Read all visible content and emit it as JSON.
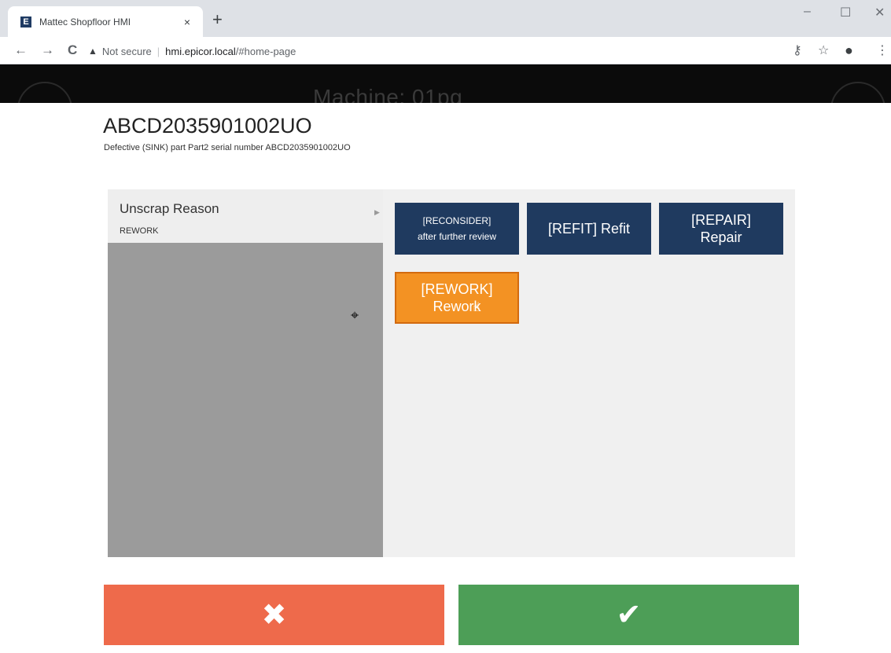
{
  "browser": {
    "tab_title": "Mattec Shopfloor HMI",
    "tab_close": "×",
    "new_tab": "+",
    "favicon_letter": "E",
    "security_label": "Not secure",
    "url_host": "hmi.epicor.local",
    "url_path": "/#home-page",
    "back_icon": "←",
    "forward_icon": "→",
    "reload_icon": "C",
    "key_icon": "⚷",
    "star_icon": "☆",
    "account_icon": "●",
    "menu_icon": "⋮",
    "minimize": "–",
    "maximize": "☐",
    "close": "✕"
  },
  "header": {
    "machine_title": "Machine: 01pg"
  },
  "dialog": {
    "serial": "ABCD2035901002UO",
    "subtitle": "Defective (SINK) part Part2 serial number ABCD2035901002UO",
    "field_label": "Unscrap Reason",
    "field_value": "REWORK",
    "options": [
      {
        "line1": "[RECONSIDER]",
        "line2": "after further review"
      },
      {
        "line1": "[REFIT] Refit",
        "line2": ""
      },
      {
        "line1": "[REPAIR]",
        "line2": "Repair"
      },
      {
        "line1": "[REWORK]",
        "line2": "Rework"
      }
    ],
    "cancel_icon": "✖",
    "confirm_icon": "✔"
  },
  "colors": {
    "option_default": "#1f3a5f",
    "option_selected": "#f39223",
    "cancel": "#ee6a4b",
    "confirm": "#4d9e57"
  }
}
